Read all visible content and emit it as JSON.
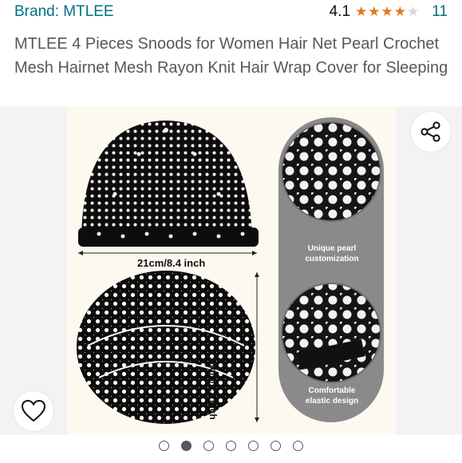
{
  "header": {
    "brand": "Brand: MTLEE",
    "rating": "4.1",
    "stars": {
      "filled": 4,
      "total": 5,
      "value": 4.1
    },
    "review_count": "11"
  },
  "product": {
    "title": "MTLEE 4 Pieces Snoods for Women Hair Net Pearl Crochet Mesh Hairnet Mesh Rayon Knit Hair Wrap Cover for Sleeping"
  },
  "image": {
    "width_label": "21cm/8.4 inch",
    "height_label": "18cm/7.2 inch",
    "feature_1_line1": "Unique pearl",
    "feature_1_line2": "customization",
    "feature_2_line1": "Comfortable",
    "feature_2_line2": "elastic design"
  },
  "gallery": {
    "image_count": 7,
    "active_index": 1
  },
  "colors": {
    "link": "#007185",
    "star": "#de7921",
    "muted_text": "#565959"
  },
  "icons": {
    "share": "share-icon",
    "wishlist": "heart-icon"
  }
}
